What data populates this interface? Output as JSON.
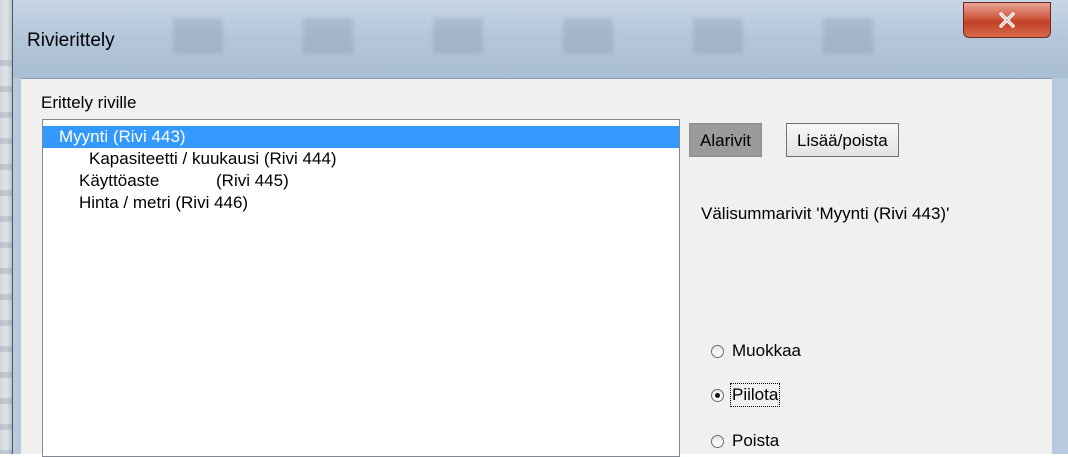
{
  "window": {
    "title": "Rivierittely",
    "close_icon": "close-icon"
  },
  "group": {
    "label": "Erittely riville"
  },
  "list": {
    "items": [
      {
        "label": "Myynti (Rivi 443)",
        "selected": true
      },
      {
        "label": "Kapasiteetti / kuukausi (Rivi 444)",
        "selected": false
      },
      {
        "label": "Käyttöaste            (Rivi 445)",
        "selected": false
      },
      {
        "label": "Hinta / metri (Rivi 446)",
        "selected": false
      }
    ]
  },
  "tabs": [
    {
      "label": "Alarivit",
      "active": true
    },
    {
      "label": "Lisää/poista",
      "active": false
    }
  ],
  "panel": {
    "subtitle": "Välisummarivit 'Myynti (Rivi 443)'",
    "options": [
      {
        "label": "Muokkaa",
        "checked": false
      },
      {
        "label": "Piilota",
        "checked": true
      },
      {
        "label": "Poista",
        "checked": false
      }
    ]
  },
  "colors": {
    "selection": "#3399ff",
    "close_button": "#c8452c",
    "title_bar": "#b5c7da"
  }
}
